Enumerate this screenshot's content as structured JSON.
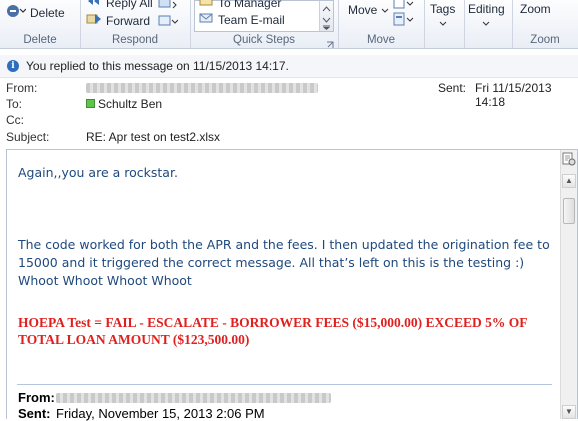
{
  "ribbon": {
    "delete_group": {
      "delete_label": "Delete",
      "group_label": "Delete"
    },
    "respond_group": {
      "reply_all_label": "Reply All",
      "forward_label": "Forward",
      "group_label": "Respond"
    },
    "quick_steps_group": {
      "to_manager_label": "To Manager",
      "team_email_label": "Team E-mail",
      "group_label": "Quick Steps"
    },
    "move_group": {
      "move_label": "Move",
      "group_label": "Move"
    },
    "tags_group": {
      "tags_label": "Tags"
    },
    "editing_group": {
      "editing_label": "Editing"
    },
    "zoom_group": {
      "zoom_label": "Zoom",
      "group_label": "Zoom"
    }
  },
  "message_header": {
    "info_text": "You replied to this message on 11/15/2013 14:17.",
    "from_label": "From:",
    "sent_label": "Sent:",
    "sent_value": "Fri 11/15/2013 14:18",
    "to_label": "To:",
    "to_value": "Schultz Ben",
    "cc_label": "Cc:",
    "subject_label": "Subject:",
    "subject_value": "RE: Apr test on test2.xlsx"
  },
  "message_body": {
    "line1": "Again,,you are a rockstar.",
    "para_line1": "The code worked for both the APR and the fees.  I  then updated the origination fee to",
    "para_line2": "15000 and it triggered the correct message. All that’s left on this is the testing :)",
    "para_line3": "Whoot Whoot Whoot Whoot",
    "alert_text": "HOEPA Test = FAIL - ESCALATE - BORROWER FEES ($15,000.00) EXCEED 5% OF TOTAL LOAN AMOUNT ($123,500.00)",
    "quoted_from_label": "From:",
    "quoted_sent_label": "Sent:",
    "quoted_sent_value": "Friday, November 15, 2013 2:06 PM"
  },
  "colors": {
    "body_text": "#1f497d",
    "alert_text": "#e0201e",
    "ribbon_label": "#5a6679"
  }
}
